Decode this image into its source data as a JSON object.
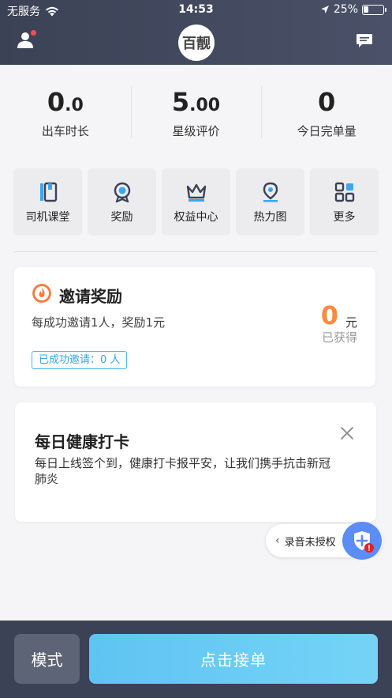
{
  "status_bar": {
    "carrier": "无服务",
    "time": "14:53",
    "battery": "25%",
    "battery_level": 0.25
  },
  "header": {
    "logo_text": "百靓"
  },
  "stats": [
    {
      "int": "0",
      "dec": ".0",
      "label": "出车时长"
    },
    {
      "int": "5",
      "dec": ".00",
      "label": "星级评价"
    },
    {
      "int": "0",
      "dec": "",
      "label": "今日完单量"
    }
  ],
  "tools": [
    {
      "label": "司机课堂",
      "icon": "book-icon"
    },
    {
      "label": "奖励",
      "icon": "medal-icon"
    },
    {
      "label": "权益中心",
      "icon": "crown-icon"
    },
    {
      "label": "热力图",
      "icon": "location-pin-icon"
    },
    {
      "label": "更多",
      "icon": "grid-icon"
    }
  ],
  "invite_card": {
    "title": "邀请奖励",
    "desc": "每成功邀请1人，奖励1元",
    "earned_value": "0",
    "earned_unit": "元",
    "earned_label": "已获得",
    "badge": "已成功邀请：0 人"
  },
  "health_card": {
    "title": "每日健康打卡",
    "desc": "每日上线签个到，健康打卡报平安，让我们携手抗击新冠肺炎"
  },
  "recording_notice": {
    "label": "录音未授权"
  },
  "bottom_bar": {
    "mode_label": "模式",
    "accept_label": "点击接单"
  },
  "colors": {
    "header": "#3b4256",
    "accent_orange": "#ff8a3d",
    "accent_blue": "#5fc4f3",
    "badge_blue": "#33a6e8"
  }
}
